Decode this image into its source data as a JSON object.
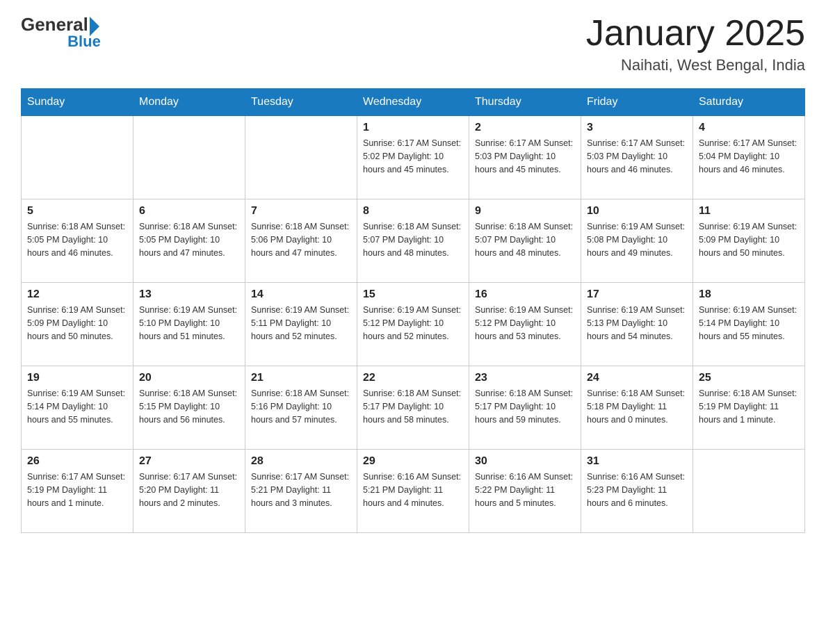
{
  "header": {
    "logo_general": "General",
    "logo_blue": "Blue",
    "title": "January 2025",
    "subtitle": "Naihati, West Bengal, India"
  },
  "days_of_week": [
    "Sunday",
    "Monday",
    "Tuesday",
    "Wednesday",
    "Thursday",
    "Friday",
    "Saturday"
  ],
  "weeks": [
    [
      {
        "day": "",
        "info": ""
      },
      {
        "day": "",
        "info": ""
      },
      {
        "day": "",
        "info": ""
      },
      {
        "day": "1",
        "info": "Sunrise: 6:17 AM\nSunset: 5:02 PM\nDaylight: 10 hours and 45 minutes."
      },
      {
        "day": "2",
        "info": "Sunrise: 6:17 AM\nSunset: 5:03 PM\nDaylight: 10 hours and 45 minutes."
      },
      {
        "day": "3",
        "info": "Sunrise: 6:17 AM\nSunset: 5:03 PM\nDaylight: 10 hours and 46 minutes."
      },
      {
        "day": "4",
        "info": "Sunrise: 6:17 AM\nSunset: 5:04 PM\nDaylight: 10 hours and 46 minutes."
      }
    ],
    [
      {
        "day": "5",
        "info": "Sunrise: 6:18 AM\nSunset: 5:05 PM\nDaylight: 10 hours and 46 minutes."
      },
      {
        "day": "6",
        "info": "Sunrise: 6:18 AM\nSunset: 5:05 PM\nDaylight: 10 hours and 47 minutes."
      },
      {
        "day": "7",
        "info": "Sunrise: 6:18 AM\nSunset: 5:06 PM\nDaylight: 10 hours and 47 minutes."
      },
      {
        "day": "8",
        "info": "Sunrise: 6:18 AM\nSunset: 5:07 PM\nDaylight: 10 hours and 48 minutes."
      },
      {
        "day": "9",
        "info": "Sunrise: 6:18 AM\nSunset: 5:07 PM\nDaylight: 10 hours and 48 minutes."
      },
      {
        "day": "10",
        "info": "Sunrise: 6:19 AM\nSunset: 5:08 PM\nDaylight: 10 hours and 49 minutes."
      },
      {
        "day": "11",
        "info": "Sunrise: 6:19 AM\nSunset: 5:09 PM\nDaylight: 10 hours and 50 minutes."
      }
    ],
    [
      {
        "day": "12",
        "info": "Sunrise: 6:19 AM\nSunset: 5:09 PM\nDaylight: 10 hours and 50 minutes."
      },
      {
        "day": "13",
        "info": "Sunrise: 6:19 AM\nSunset: 5:10 PM\nDaylight: 10 hours and 51 minutes."
      },
      {
        "day": "14",
        "info": "Sunrise: 6:19 AM\nSunset: 5:11 PM\nDaylight: 10 hours and 52 minutes."
      },
      {
        "day": "15",
        "info": "Sunrise: 6:19 AM\nSunset: 5:12 PM\nDaylight: 10 hours and 52 minutes."
      },
      {
        "day": "16",
        "info": "Sunrise: 6:19 AM\nSunset: 5:12 PM\nDaylight: 10 hours and 53 minutes."
      },
      {
        "day": "17",
        "info": "Sunrise: 6:19 AM\nSunset: 5:13 PM\nDaylight: 10 hours and 54 minutes."
      },
      {
        "day": "18",
        "info": "Sunrise: 6:19 AM\nSunset: 5:14 PM\nDaylight: 10 hours and 55 minutes."
      }
    ],
    [
      {
        "day": "19",
        "info": "Sunrise: 6:19 AM\nSunset: 5:14 PM\nDaylight: 10 hours and 55 minutes."
      },
      {
        "day": "20",
        "info": "Sunrise: 6:18 AM\nSunset: 5:15 PM\nDaylight: 10 hours and 56 minutes."
      },
      {
        "day": "21",
        "info": "Sunrise: 6:18 AM\nSunset: 5:16 PM\nDaylight: 10 hours and 57 minutes."
      },
      {
        "day": "22",
        "info": "Sunrise: 6:18 AM\nSunset: 5:17 PM\nDaylight: 10 hours and 58 minutes."
      },
      {
        "day": "23",
        "info": "Sunrise: 6:18 AM\nSunset: 5:17 PM\nDaylight: 10 hours and 59 minutes."
      },
      {
        "day": "24",
        "info": "Sunrise: 6:18 AM\nSunset: 5:18 PM\nDaylight: 11 hours and 0 minutes."
      },
      {
        "day": "25",
        "info": "Sunrise: 6:18 AM\nSunset: 5:19 PM\nDaylight: 11 hours and 1 minute."
      }
    ],
    [
      {
        "day": "26",
        "info": "Sunrise: 6:17 AM\nSunset: 5:19 PM\nDaylight: 11 hours and 1 minute."
      },
      {
        "day": "27",
        "info": "Sunrise: 6:17 AM\nSunset: 5:20 PM\nDaylight: 11 hours and 2 minutes."
      },
      {
        "day": "28",
        "info": "Sunrise: 6:17 AM\nSunset: 5:21 PM\nDaylight: 11 hours and 3 minutes."
      },
      {
        "day": "29",
        "info": "Sunrise: 6:16 AM\nSunset: 5:21 PM\nDaylight: 11 hours and 4 minutes."
      },
      {
        "day": "30",
        "info": "Sunrise: 6:16 AM\nSunset: 5:22 PM\nDaylight: 11 hours and 5 minutes."
      },
      {
        "day": "31",
        "info": "Sunrise: 6:16 AM\nSunset: 5:23 PM\nDaylight: 11 hours and 6 minutes."
      },
      {
        "day": "",
        "info": ""
      }
    ]
  ]
}
